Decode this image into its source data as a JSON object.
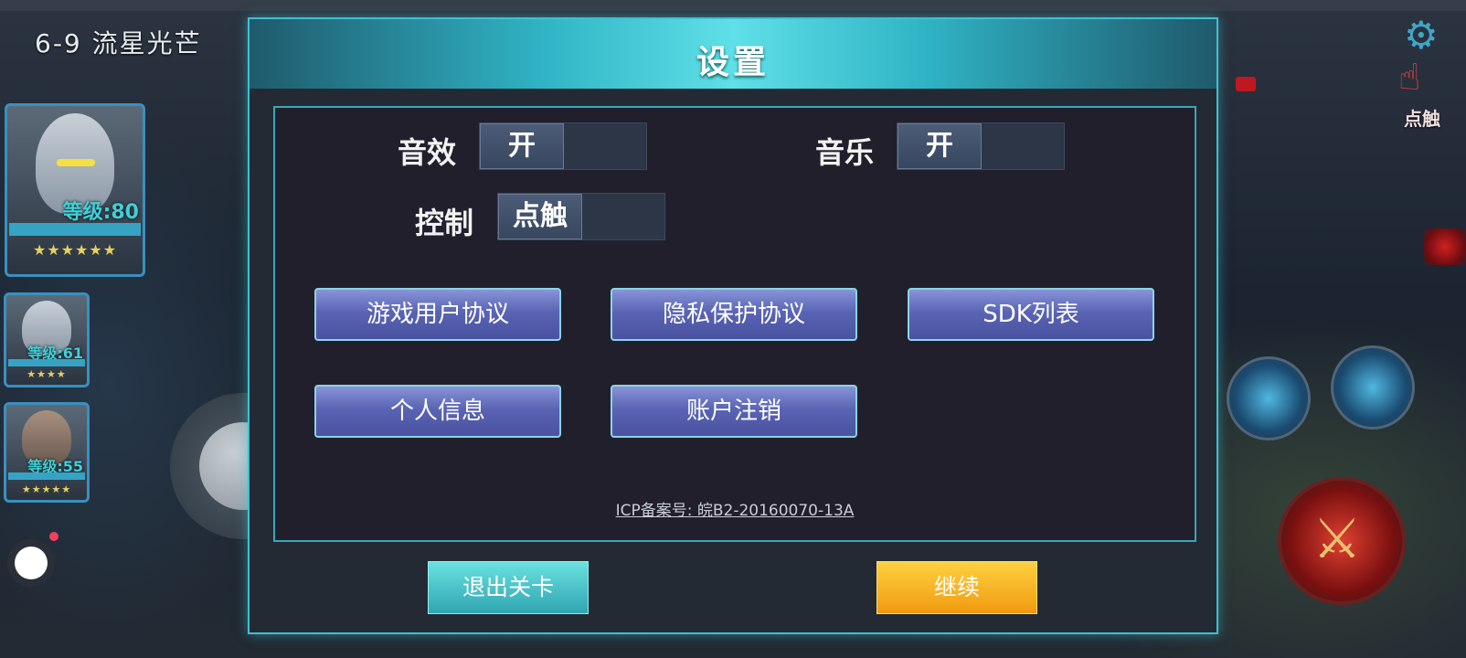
{
  "stage": {
    "name": "6-9 流星光芒"
  },
  "heroes": [
    {
      "level": "等级:80",
      "stars": "★★★★★★"
    },
    {
      "level": "等级:61",
      "stars": "★★★★"
    },
    {
      "level": "等级:55",
      "stars": "★★★★★"
    }
  ],
  "hud": {
    "touch_label": "点触",
    "gear_icon": "gear-icon"
  },
  "dialog": {
    "title": "设置",
    "sound": {
      "label": "音效",
      "value": "开"
    },
    "music": {
      "label": "音乐",
      "value": "开"
    },
    "control": {
      "label": "控制",
      "value": "点触"
    },
    "buttons": {
      "user_agreement": "游戏用户协议",
      "privacy": "隐私保护协议",
      "sdk_list": "SDK列表",
      "personal_info": "个人信息",
      "account_cancel": "账户注销"
    },
    "icp": "ICP备案号: 皖B2-20160070-13A",
    "exit": "退出关卡",
    "continue": "继续"
  },
  "colors": {
    "accent": "#3fc0d0",
    "continue": "#f5b21e",
    "exit": "#3fbcc4",
    "button": "#5a64b4"
  }
}
